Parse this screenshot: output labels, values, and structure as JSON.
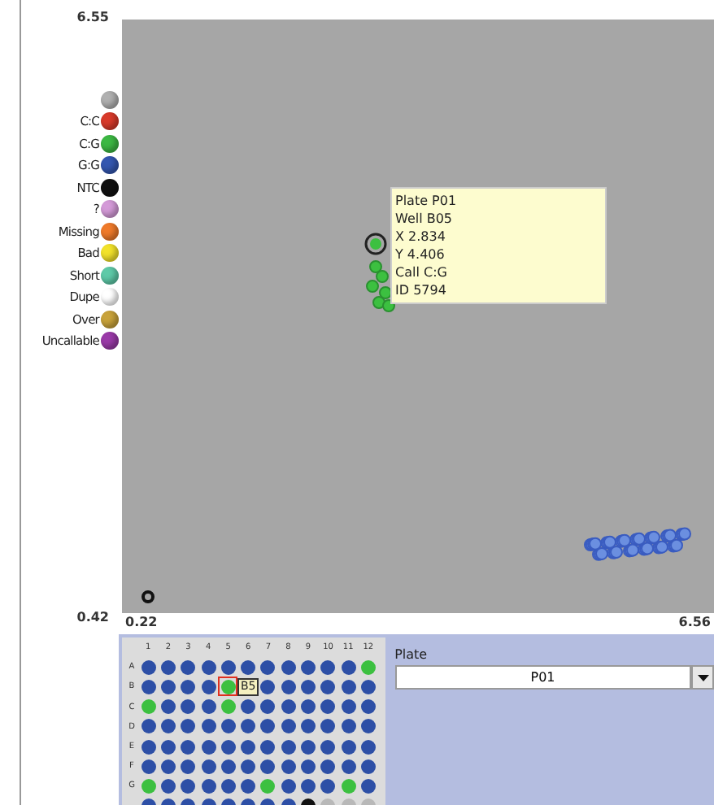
{
  "legend": [
    {
      "color": "#b0b0b0"
    },
    {
      "label": "C:C",
      "color": "#d83a2a"
    },
    {
      "label": "C:G",
      "color": "#3cb843"
    },
    {
      "label": "G:G",
      "color": "#3457b0"
    },
    {
      "label": "NTC",
      "color": "#111111"
    },
    {
      "label": "?",
      "color": "#d49ad8"
    },
    {
      "label": "Missing",
      "color": "#ef7a2a"
    },
    {
      "label": "Bad",
      "color": "#f2e22a"
    },
    {
      "label": "Short",
      "color": "#5ecaa8"
    },
    {
      "label": "Dupe",
      "color": "#ffffff"
    },
    {
      "label": "Over",
      "color": "#c8a23a"
    },
    {
      "label": "Uncallable",
      "color": "#9a3aa8"
    }
  ],
  "plot": {
    "y_max": "6.55",
    "y_min": "0.42",
    "x_min": "0.22",
    "x_max": "6.56",
    "tooltip": [
      "Plate P01",
      "Well B05",
      "X 2.834",
      "Y 4.406",
      "Call C:G",
      "ID 5794"
    ]
  },
  "plate": {
    "columns": [
      "1",
      "2",
      "3",
      "4",
      "5",
      "6",
      "7",
      "8",
      "9",
      "10",
      "11",
      "12"
    ],
    "rows": [
      {
        "label": "A",
        "wells": [
          {
            "color": "#2d4fa6",
            "selected": false
          },
          {
            "color": "#2d4fa6",
            "selected": false
          },
          {
            "color": "#2d4fa6",
            "selected": false
          },
          {
            "color": "#2d4fa6",
            "selected": false
          },
          {
            "color": "#2d4fa6",
            "selected": false
          },
          {
            "color": "#2d4fa6",
            "selected": false
          },
          {
            "color": "#2d4fa6",
            "selected": false
          },
          {
            "color": "#2d4fa6",
            "selected": false
          },
          {
            "color": "#2d4fa6",
            "selected": false
          },
          {
            "color": "#2d4fa6",
            "selected": false
          },
          {
            "color": "#2d4fa6",
            "selected": false
          },
          {
            "color": "#3cc040",
            "selected": false
          }
        ]
      },
      {
        "label": "B",
        "wells": [
          {
            "color": "#2d4fa6",
            "selected": false
          },
          {
            "color": "#2d4fa6",
            "selected": false
          },
          {
            "color": "#2d4fa6",
            "selected": false
          },
          {
            "color": "#2d4fa6",
            "selected": false
          },
          {
            "color": "#3cc040",
            "selected": true
          },
          {
            "color": "#2d4fa6",
            "selected": false
          },
          {
            "color": "#2d4fa6",
            "selected": false
          },
          {
            "color": "#2d4fa6",
            "selected": false
          },
          {
            "color": "#2d4fa6",
            "selected": false
          },
          {
            "color": "#2d4fa6",
            "selected": false
          },
          {
            "color": "#2d4fa6",
            "selected": false
          }
        ]
      },
      {
        "label": "C",
        "wells": [
          {
            "color": "#3cc040",
            "selected": false
          },
          {
            "color": "#2d4fa6",
            "selected": false
          },
          {
            "color": "#2d4fa6",
            "selected": false
          },
          {
            "color": "#2d4fa6",
            "selected": false
          },
          {
            "color": "#3cc040",
            "selected": false
          },
          {
            "color": "#2d4fa6",
            "selected": false
          },
          {
            "color": "#2d4fa6",
            "selected": false
          },
          {
            "color": "#2d4fa6",
            "selected": false
          },
          {
            "color": "#2d4fa6",
            "selected": false
          },
          {
            "color": "#2d4fa6",
            "selected": false
          },
          {
            "color": "#2d4fa6",
            "selected": false
          },
          {
            "color": "#2d4fa6",
            "selected": false
          }
        ]
      },
      {
        "label": "D",
        "wells": [
          {
            "color": "#2d4fa6",
            "selected": false
          },
          {
            "color": "#2d4fa6",
            "selected": false
          },
          {
            "color": "#2d4fa6",
            "selected": false
          },
          {
            "color": "#2d4fa6",
            "selected": false
          },
          {
            "color": "#2d4fa6",
            "selected": false
          },
          {
            "color": "#2d4fa6",
            "selected": false
          },
          {
            "color": "#2d4fa6",
            "selected": false
          },
          {
            "color": "#2d4fa6",
            "selected": false
          },
          {
            "color": "#2d4fa6",
            "selected": false
          },
          {
            "color": "#2d4fa6",
            "selected": false
          },
          {
            "color": "#2d4fa6",
            "selected": false
          },
          {
            "color": "#2d4fa6",
            "selected": false
          }
        ]
      },
      {
        "label": "E",
        "wells": [
          {
            "color": "#2d4fa6",
            "selected": false
          },
          {
            "color": "#2d4fa6",
            "selected": false
          },
          {
            "color": "#2d4fa6",
            "selected": false
          },
          {
            "color": "#2d4fa6",
            "selected": false
          },
          {
            "color": "#2d4fa6",
            "selected": false
          },
          {
            "color": "#2d4fa6",
            "selected": false
          },
          {
            "color": "#2d4fa6",
            "selected": false
          },
          {
            "color": "#2d4fa6",
            "selected": false
          },
          {
            "color": "#2d4fa6",
            "selected": false
          },
          {
            "color": "#2d4fa6",
            "selected": false
          },
          {
            "color": "#2d4fa6",
            "selected": false
          },
          {
            "color": "#2d4fa6",
            "selected": false
          }
        ]
      },
      {
        "label": "F",
        "wells": [
          {
            "color": "#2d4fa6",
            "selected": false
          },
          {
            "color": "#2d4fa6",
            "selected": false
          },
          {
            "color": "#2d4fa6",
            "selected": false
          },
          {
            "color": "#2d4fa6",
            "selected": false
          },
          {
            "color": "#2d4fa6",
            "selected": false
          },
          {
            "color": "#2d4fa6",
            "selected": false
          },
          {
            "color": "#2d4fa6",
            "selected": false
          },
          {
            "color": "#2d4fa6",
            "selected": false
          },
          {
            "color": "#2d4fa6",
            "selected": false
          },
          {
            "color": "#2d4fa6",
            "selected": false
          },
          {
            "color": "#2d4fa6",
            "selected": false
          },
          {
            "color": "#2d4fa6",
            "selected": false
          }
        ]
      },
      {
        "label": "G",
        "wells": [
          {
            "color": "#3cc040",
            "selected": false
          },
          {
            "color": "#2d4fa6",
            "selected": false
          },
          {
            "color": "#2d4fa6",
            "selected": false
          },
          {
            "color": "#2d4fa6",
            "selected": false
          },
          {
            "color": "#2d4fa6",
            "selected": false
          },
          {
            "color": "#2d4fa6",
            "selected": false
          },
          {
            "color": "#3cc040",
            "selected": false
          },
          {
            "color": "#2d4fa6",
            "selected": false
          },
          {
            "color": "#2d4fa6",
            "selected": false
          },
          {
            "color": "#2d4fa6",
            "selected": false
          },
          {
            "color": "#3cc040",
            "selected": false
          },
          {
            "color": "#2d4fa6",
            "selected": false
          }
        ]
      },
      {
        "wells": [
          {
            "color": "#2d4fa6",
            "selected": false
          },
          {
            "color": "#2d4fa6",
            "selected": false
          },
          {
            "color": "#2d4fa6",
            "selected": false
          },
          {
            "color": "#2d4fa6",
            "selected": false
          },
          {
            "color": "#2d4fa6",
            "selected": false
          },
          {
            "color": "#2d4fa6",
            "selected": false
          },
          {
            "color": "#2d4fa6",
            "selected": false
          },
          {
            "color": "#2d4fa6",
            "selected": false
          },
          {
            "color": "#111111",
            "selected": false
          },
          {
            "color": "#b8b8b8",
            "selected": false
          },
          {
            "color": "#b8b8b8",
            "selected": false
          },
          {
            "color": "#b8b8b8",
            "selected": false
          }
        ]
      }
    ],
    "tag": "B5"
  },
  "plate_select": {
    "label": "Plate",
    "value": "P01"
  }
}
